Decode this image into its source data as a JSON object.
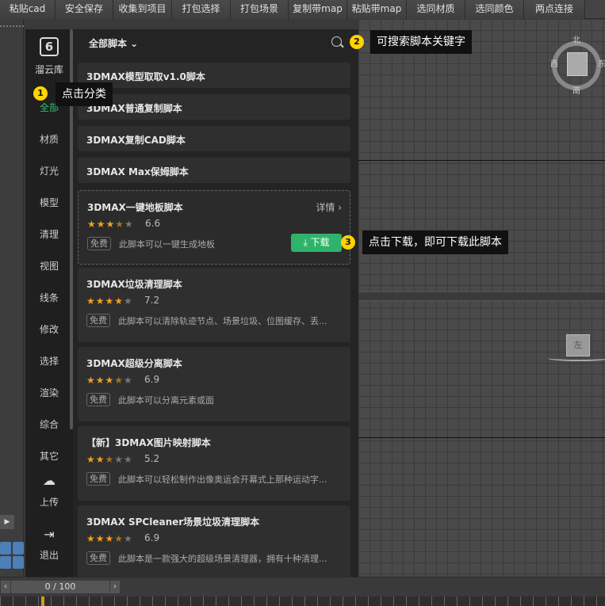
{
  "toolbar": [
    "粘贴cad",
    "安全保存",
    "收集到项目",
    "打包选择",
    "打包场景",
    "复制带map",
    "粘贴带map",
    "选同材质",
    "选同颜色",
    "两点连接"
  ],
  "nav": {
    "brand": "溜云库",
    "items": [
      "全部",
      "材质",
      "灯光",
      "模型",
      "清理",
      "视图",
      "线条",
      "修改",
      "选择",
      "渲染",
      "综合",
      "其它"
    ],
    "active": "全部",
    "upload": "上传",
    "exit": "退出"
  },
  "header": {
    "category": "全部脚本 ⌄"
  },
  "simple_scripts": [
    "3DMAX模型取取v1.0脚本",
    "3DMAX普通复制脚本",
    "3DMAX复制CAD脚本",
    "3DMAX Max保姆脚本"
  ],
  "scripts": [
    {
      "title": "3DMAX一键地板脚本",
      "rating": "6.6",
      "stars": 3.5,
      "free": "免费",
      "desc": "此脚本可以一键生成地板",
      "detail": "详情 ›",
      "download": "⤓ 下载"
    },
    {
      "title": "3DMAX垃圾清理脚本",
      "rating": "7.2",
      "stars": 4,
      "free": "免费",
      "desc": "此脚本可以清除轨迹节点、场景垃圾、位图缓存、丢..."
    },
    {
      "title": "3DMAX超级分离脚本",
      "rating": "6.9",
      "stars": 3.5,
      "free": "免费",
      "desc": "此脚本可以分离元素或面"
    },
    {
      "title": "【新】3DMAX图片映射脚本",
      "rating": "5.2",
      "stars": 2.5,
      "free": "免费",
      "desc": "此脚本可以轻松制作出像奥运会开幕式上那种运动字..."
    },
    {
      "title": "3DMAX SPCleaner场景垃圾清理脚本",
      "rating": "6.9",
      "stars": 3.5,
      "free": "免费",
      "desc": "此脚本是一款强大的超级场景清理器，拥有十种清理..."
    }
  ],
  "tips": {
    "t1": {
      "num": "1",
      "text": "点击分类"
    },
    "t2": {
      "num": "2",
      "text": "可搜索脚本关键字"
    },
    "t3": {
      "num": "3",
      "text": "点击下载，即可下载此脚本"
    }
  },
  "viewport": {
    "compass_n": "北",
    "compass_s": "南",
    "compass_w": "西",
    "compass_e": "东",
    "cube_top": "顶",
    "cube_left": "左"
  },
  "timeline": {
    "frame": "0 / 100",
    "prev": "‹",
    "next": "›"
  }
}
